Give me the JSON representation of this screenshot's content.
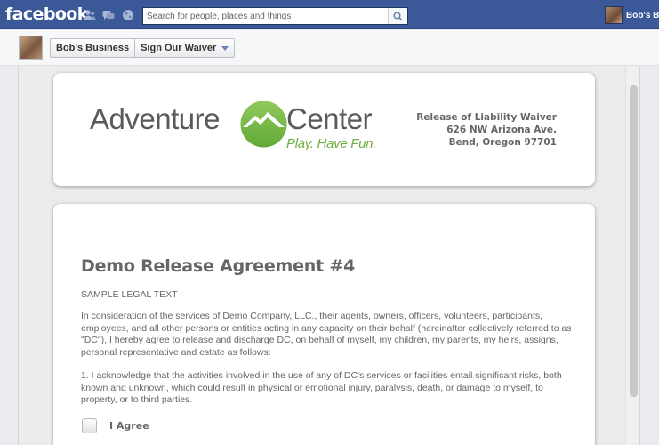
{
  "topbar": {
    "logo": "facebook",
    "search_placeholder": "Search for people, places and things",
    "user_name": "Bob's B"
  },
  "page": {
    "crumb_page": "Bob's Business",
    "crumb_app": "Sign Our Waiver"
  },
  "brand": {
    "name_left": "Adventure",
    "name_right": "Center",
    "tagline": "Play. Have Fun.",
    "green": "#6fae3f"
  },
  "address": {
    "line1": "Release of Liability Waiver",
    "line2": "626 NW Arizona Ave.",
    "line3": "Bend, Oregon 97701"
  },
  "document": {
    "title": "Demo Release Agreement #4",
    "subtitle": "SAMPLE LEGAL TEXT",
    "paragraph1": "In consideration of the services of Demo Company, LLC., their agents, owners, officers, volunteers, participants, employees, and all other persons or entities acting in any capacity on their behalf (hereinafter collectively referred to as \"DC\"), I hereby agree to release and discharge DC, on behalf of myself, my children, my parents, my heirs, assigns, personal representative and estate as follows:",
    "paragraph2": "1. I acknowledge that the activities involved in the use of any of DC's services or facilities entail significant risks, both known and unknown, which could result in physical or emotional injury, paralysis, death, or damage to myself, to property, or to third parties.",
    "agree_label": "I Agree"
  }
}
